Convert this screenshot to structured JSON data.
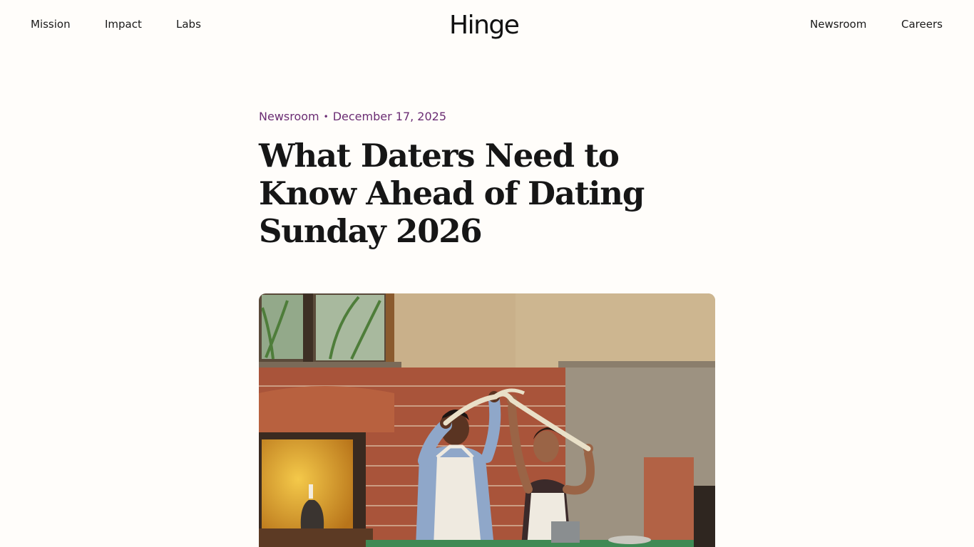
{
  "nav": {
    "left": [
      "Mission",
      "Impact",
      "Labs"
    ],
    "right": [
      "Newsroom",
      "Careers"
    ],
    "logo_text": "Hinge"
  },
  "article": {
    "category": "Newsroom",
    "separator": "•",
    "date": "December 17, 2025",
    "title": "What Daters Need to Know Ahead of Dating Sunday 2026"
  },
  "hero_image": {
    "icon": "couple-making-pasta-photo"
  },
  "colors": {
    "background": "#FFFDFA",
    "accent": "#6b2d73",
    "text": "#161616"
  }
}
